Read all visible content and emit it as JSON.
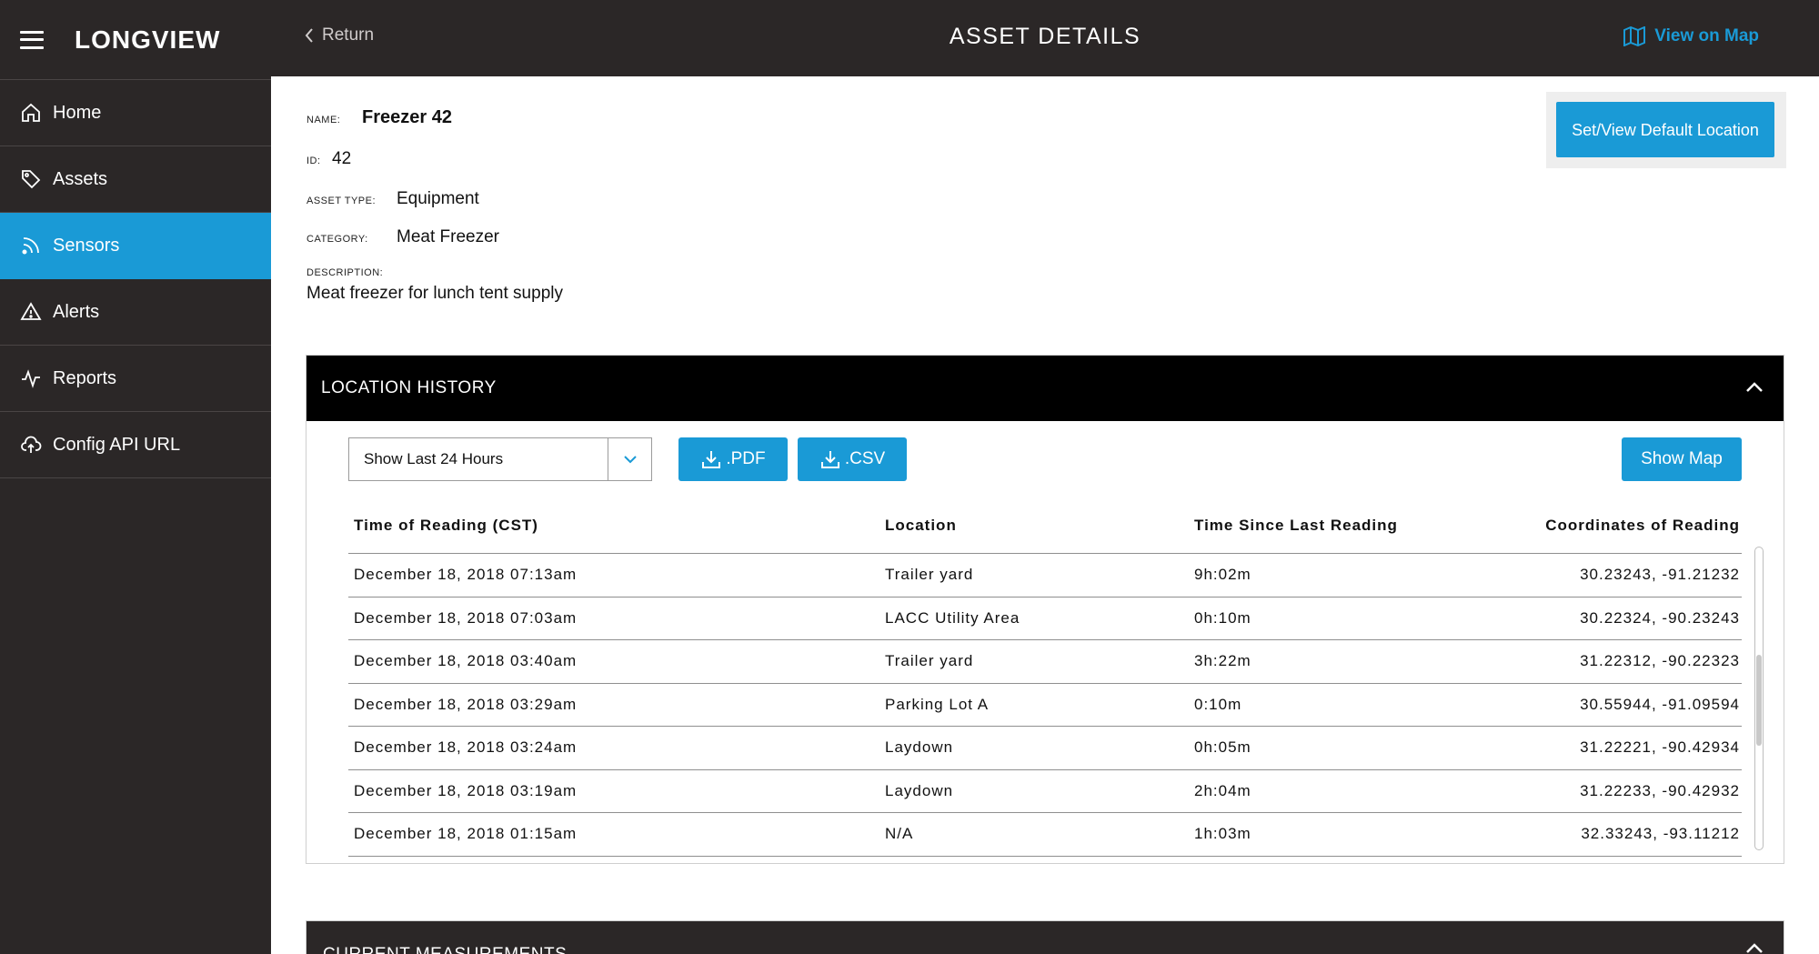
{
  "brand": {
    "logo": "LONGVIEW"
  },
  "sidebar": {
    "items": [
      {
        "label": "Home",
        "icon": "home-icon"
      },
      {
        "label": "Assets",
        "icon": "tag-icon"
      },
      {
        "label": "Sensors",
        "icon": "signal-icon",
        "active": true
      },
      {
        "label": "Alerts",
        "icon": "warning-icon"
      },
      {
        "label": "Reports",
        "icon": "activity-icon"
      },
      {
        "label": "Config API URL",
        "icon": "cloud-upload-icon"
      }
    ]
  },
  "header": {
    "return_label": "Return",
    "title": "ASSET DETAILS",
    "view_map_label": "View on Map"
  },
  "asset": {
    "name_label": "NAME:",
    "name": "Freezer 42",
    "id_label": "ID:",
    "id": "42",
    "type_label": "ASSET TYPE:",
    "type": "Equipment",
    "category_label": "CATEGORY:",
    "category": "Meat Freezer",
    "description_label": "DESCRIPTION:",
    "description": "Meat freezer for lunch tent supply"
  },
  "default_location_button": "Set/View Default Location",
  "location_history": {
    "title": "LOCATION HISTORY",
    "range_select": "Show Last 24 Hours",
    "pdf_label": ".PDF",
    "csv_label": ".CSV",
    "show_map_label": "Show Map",
    "columns": [
      "Time of Reading (CST)",
      "Location",
      "Time Since Last Reading",
      "Coordinates of Reading"
    ],
    "rows": [
      [
        "December 18, 2018 07:13am",
        "Trailer yard",
        "9h:02m",
        "30.23243, -91.21232"
      ],
      [
        "December 18, 2018 07:03am",
        "LACC Utility Area",
        "0h:10m",
        "30.22324, -90.23243"
      ],
      [
        "December 18, 2018 03:40am",
        "Trailer yard",
        "3h:22m",
        "31.22312, -90.22323"
      ],
      [
        "December 18, 2018 03:29am",
        "Parking Lot A",
        "0:10m",
        "30.55944, -91.09594"
      ],
      [
        "December 18, 2018 03:24am",
        "Laydown",
        "0h:05m",
        "31.22221, -90.42934"
      ],
      [
        "December 18, 2018 03:19am",
        "Laydown",
        "2h:04m",
        "31.22233, -90.42932"
      ],
      [
        "December 18, 2018 01:15am",
        "N/A",
        "1h:03m",
        "32.33243, -93.11212"
      ]
    ]
  },
  "current_measurements": {
    "title": "CURRENT MEASUREMENTS"
  },
  "colors": {
    "accent": "#1a9ad6",
    "sidebar_bg": "#2b2727",
    "panel_header_bg": "#000000"
  }
}
